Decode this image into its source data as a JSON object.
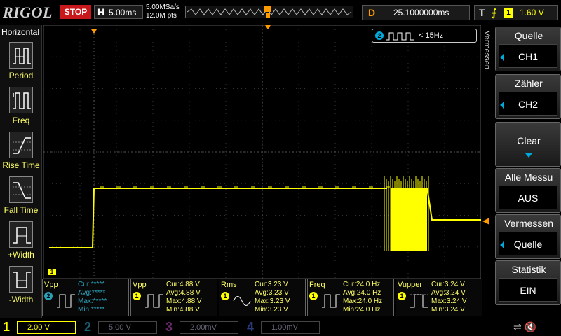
{
  "topbar": {
    "brand": "RIGOL",
    "run_state": "STOP",
    "horizontal_label": "H",
    "timebase": "5.00ms",
    "sample_rate": "5.00MSa/s",
    "memory_depth": "12.0M pts",
    "delay_label": "D",
    "delay_value": "25.1000000ms",
    "trigger_label": "T",
    "trigger_edge_icon": "rising-edge-icon",
    "trigger_source": "1",
    "trigger_level": "1.60 V"
  },
  "left_menu": {
    "title": "Horizontal",
    "items": [
      {
        "label": "Period",
        "icon": "period-icon"
      },
      {
        "label": "Freq",
        "icon": "freq-icon"
      },
      {
        "label": "Rise Time",
        "icon": "rise-time-icon"
      },
      {
        "label": "Fall Time",
        "icon": "fall-time-icon"
      },
      {
        "label": "+Width",
        "icon": "positive-width-icon"
      },
      {
        "label": "-Width",
        "icon": "negative-width-icon"
      }
    ]
  },
  "grid": {
    "channel_tag": "2",
    "freq_readout": "< 15Hz",
    "channel_marker": "1",
    "trace_color": "#ffff00"
  },
  "right_menu": {
    "vertical_title": "Vermessen",
    "buttons": [
      {
        "label": "Quelle",
        "value": "CH1"
      },
      {
        "label": "Zähler",
        "value": "CH2"
      },
      {
        "label": "Clear",
        "value": ""
      },
      {
        "label": "Alle Messu",
        "value": "AUS"
      },
      {
        "label": "Vermessen",
        "value": "Quelle"
      },
      {
        "label": "Statistik",
        "value": "EIN"
      }
    ]
  },
  "measurements": [
    {
      "name": "Vpp",
      "source": "2",
      "cur": "Cur:*****",
      "avg": "Avg:*****",
      "max": "Max:*****",
      "min": "Min:*****"
    },
    {
      "name": "Vpp",
      "source": "1",
      "cur": "Cur:4.88 V",
      "avg": "Avg:4.88 V",
      "max": "Max:4.88 V",
      "min": "Min:4.88 V"
    },
    {
      "name": "Rms",
      "source": "1",
      "cur": "Cur:3.23 V",
      "avg": "Avg:3.23 V",
      "max": "Max:3.23 V",
      "min": "Min:3.23 V"
    },
    {
      "name": "Freq",
      "source": "1",
      "cur": "Cur:24.0 Hz",
      "avg": "Avg:24.0 Hz",
      "max": "Max:24.0 Hz",
      "min": "Min:24.0 Hz"
    },
    {
      "name": "Vupper",
      "source": "1",
      "cur": "Cur:3.24 V",
      "avg": "Avg:3.24 V",
      "max": "Max:3.24 V",
      "min": "Min:3.24 V"
    }
  ],
  "channels": [
    {
      "num": "1",
      "scale": "2.00 V",
      "color": "#ffff00",
      "active": true
    },
    {
      "num": "2",
      "scale": "5.00 V",
      "color": "#2aa0b8",
      "active": false
    },
    {
      "num": "3",
      "scale": "2.00mV",
      "color": "#c040c0",
      "active": false
    },
    {
      "num": "4",
      "scale": "1.00mV",
      "color": "#3060ff",
      "active": false
    }
  ],
  "colors": {
    "ch1": "#ffff00",
    "ch2": "#2aa0b8",
    "trigger": "#ff9a00",
    "stop": "#c8181c"
  }
}
